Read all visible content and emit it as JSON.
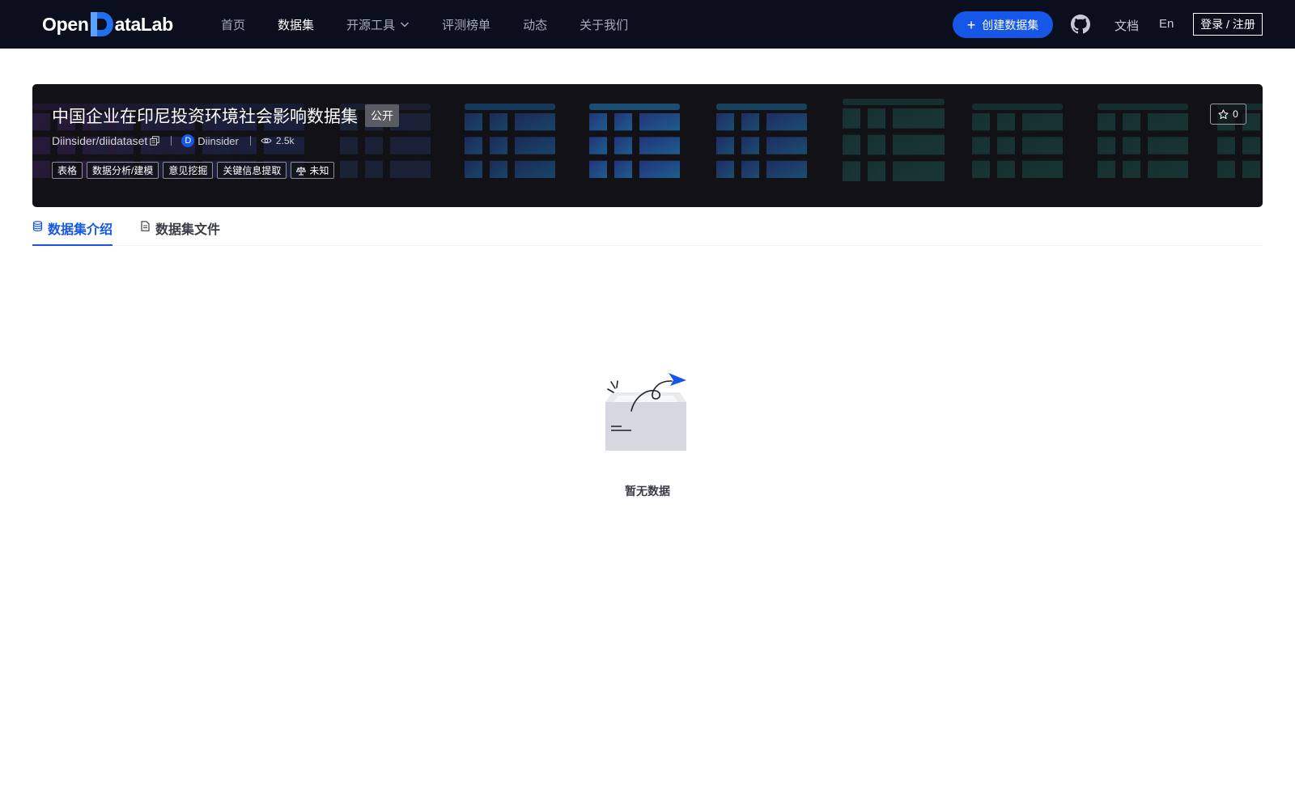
{
  "navbar": {
    "logo": {
      "part1": "Open",
      "part2": "ataLab"
    },
    "items": [
      {
        "label": "首页",
        "active": false
      },
      {
        "label": "数据集",
        "active": true
      },
      {
        "label": "开源工具",
        "active": false,
        "has_dropdown": true
      },
      {
        "label": "评测榜单",
        "active": false
      },
      {
        "label": "动态",
        "active": false
      },
      {
        "label": "关于我们",
        "active": false
      }
    ],
    "create_button": "创建数据集",
    "github_icon": "github-icon",
    "docs": "文档",
    "lang": "En",
    "login": "登录 / 注册"
  },
  "dataset": {
    "title": "中国企业在印尼投资环境社会影响数据集",
    "visibility": "公开",
    "repo": "Diinsider/diidataset",
    "owner_initial": "D",
    "owner": "Diinsider",
    "views": "2.5k",
    "tags": [
      "表格",
      "数据分析/建模",
      "意见挖掘",
      "关键信息提取"
    ],
    "license": "未知",
    "stars": "0"
  },
  "tabs": [
    {
      "label": "数据集介绍",
      "active": true
    },
    {
      "label": "数据集文件",
      "active": false
    }
  ],
  "empty": {
    "text": "暂无数据"
  },
  "colors": {
    "nav_bg": "#0b0e1c",
    "primary": "#1657e8",
    "banner_bg": "#111116"
  }
}
